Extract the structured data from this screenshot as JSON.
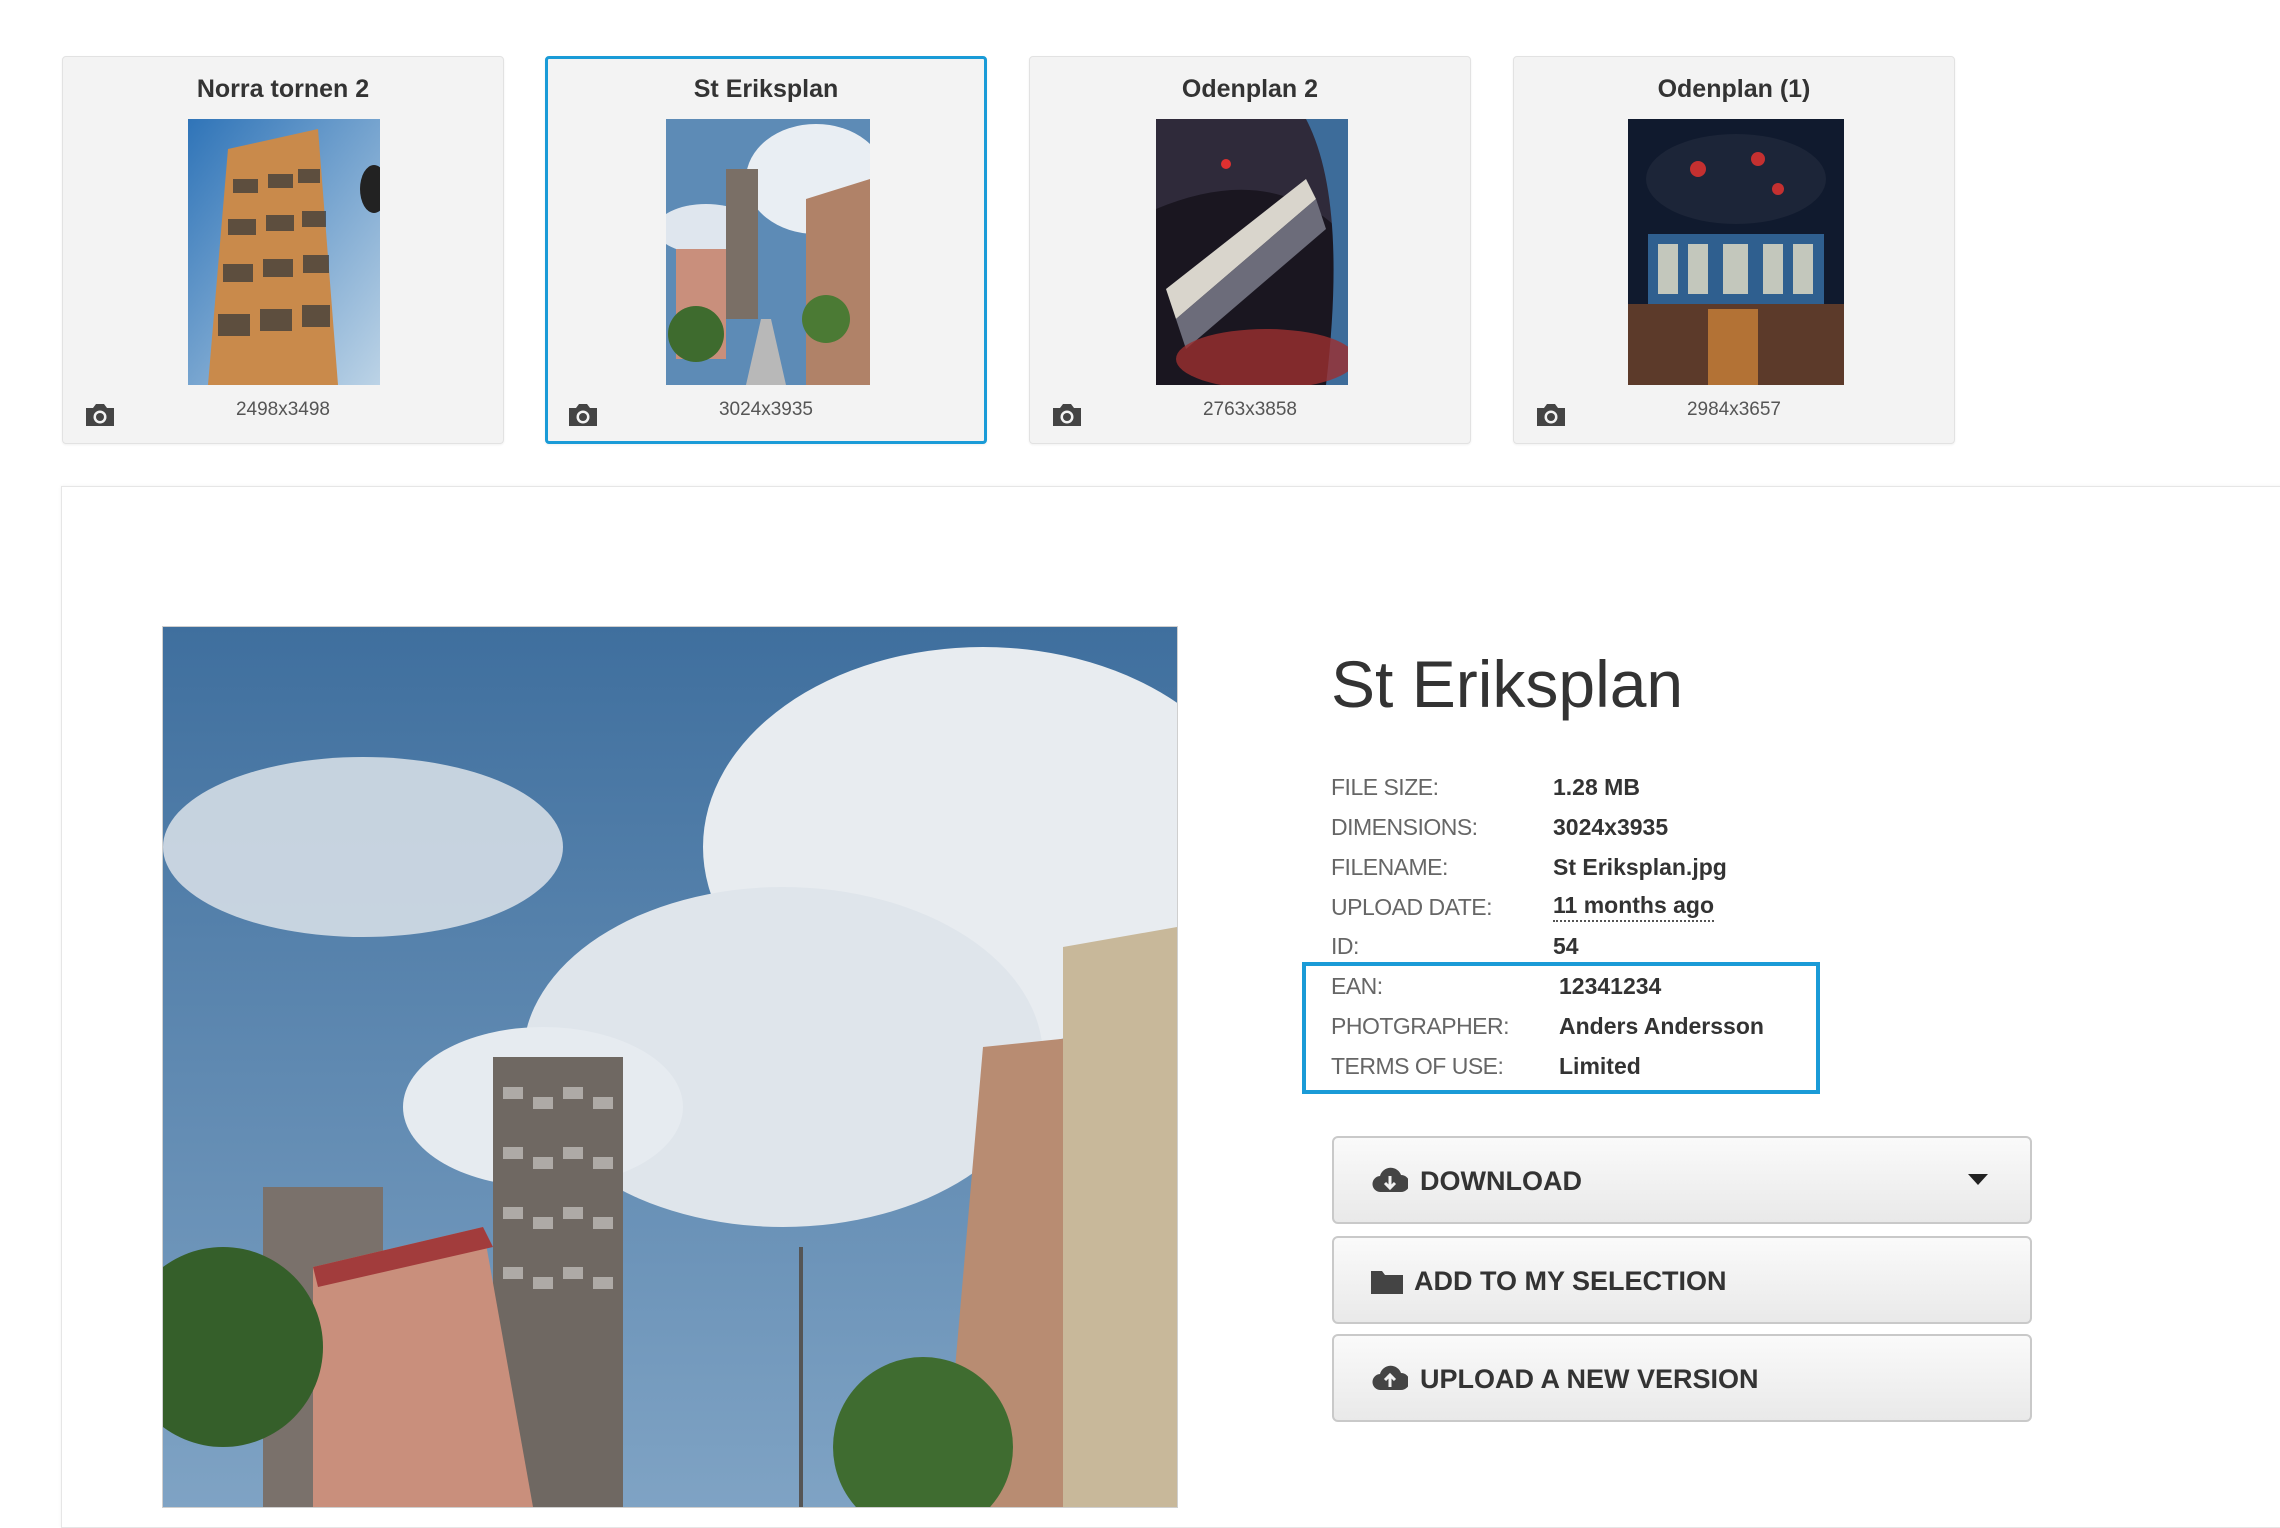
{
  "thumbnails": [
    {
      "title": "Norra tornen 2",
      "dimensions": "2498x3498",
      "selected": false
    },
    {
      "title": "St Eriksplan",
      "dimensions": "3024x3935",
      "selected": true
    },
    {
      "title": "Odenplan 2",
      "dimensions": "2763x3858",
      "selected": false
    },
    {
      "title": "Odenplan (1)",
      "dimensions": "2984x3657",
      "selected": false
    }
  ],
  "detail": {
    "title": "St Eriksplan",
    "meta": [
      {
        "label": "FILE SIZE:",
        "value": "1.28 MB"
      },
      {
        "label": "DIMENSIONS:",
        "value": "3024x3935"
      },
      {
        "label": "FILENAME:",
        "value": "St Eriksplan.jpg"
      },
      {
        "label": "UPLOAD DATE:",
        "value": "11 months ago"
      },
      {
        "label": "ID:",
        "value": "54"
      },
      {
        "label": "EAN:",
        "value": "12341234"
      },
      {
        "label": "PHOTGRAPHER:",
        "value": "Anders Andersson"
      },
      {
        "label": "TERMS OF USE:",
        "value": "Limited"
      }
    ]
  },
  "actions": {
    "download": "DOWNLOAD",
    "add_selection": "ADD TO MY SELECTION",
    "upload_version": "UPLOAD A NEW VERSION"
  },
  "icons": {
    "thumbnail_type": "camera-icon",
    "download": "cloud-download-icon",
    "selection": "folder-icon",
    "upload": "cloud-upload-icon",
    "dropdown": "caret-down-icon"
  },
  "colors": {
    "accent": "#1a9bd7",
    "card_bg": "#f3f3f3"
  }
}
